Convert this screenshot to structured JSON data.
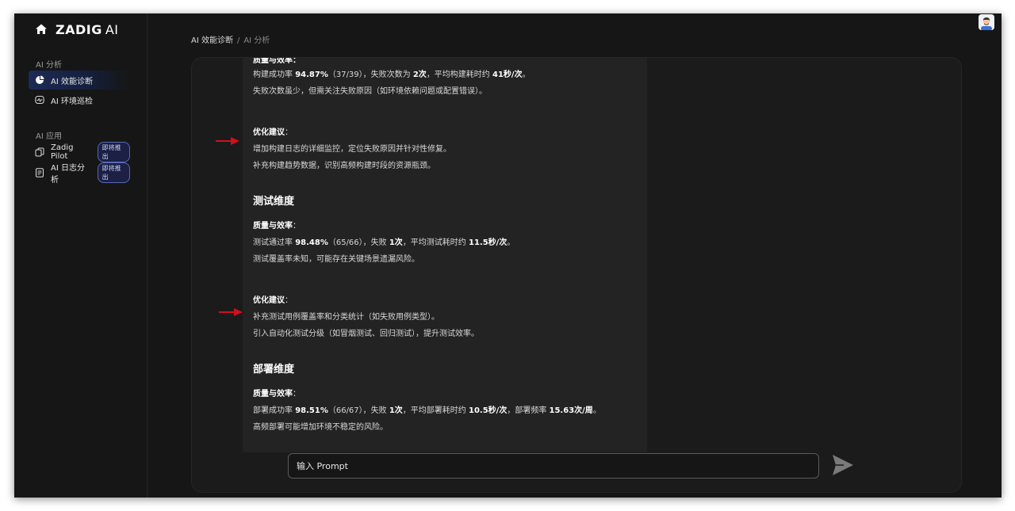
{
  "app": {
    "brand": "ZADIG",
    "brand_ai": "AI"
  },
  "sidebar": {
    "section1": "AI 分析",
    "items1": [
      {
        "label": "AI 效能诊断",
        "active": true
      },
      {
        "label": "AI 环境巡检"
      }
    ],
    "section2": "AI 应用",
    "items2": [
      {
        "label": "Zadig Pilot",
        "badge": "即将推出"
      },
      {
        "label": "AI 日志分析",
        "badge": "即将推出"
      }
    ]
  },
  "breadcrumb": {
    "parent": "AI 效能诊断",
    "sep": "/",
    "current": "AI 分析"
  },
  "report": {
    "build_top_heading": "质量与效率：",
    "build_metrics": {
      "pre1": "构建成功率 ",
      "v1": "94.87%",
      "pre2": "（37/39），失败次数为 ",
      "v2": "2次",
      "pre3": "，平均构建耗时约 ",
      "v3": "41秒/次",
      "post": "。"
    },
    "build_note": "失败次数虽少，但需关注失败原因（如环境依赖问题或配置错误）。",
    "build_opt_heading": "优化建议",
    "build_opt_colon": "：",
    "build_opt_1": "增加构建日志的详细监控，定位失败原因并针对性修复。",
    "build_opt_2": "补充构建趋势数据，识别高频构建时段的资源瓶颈。",
    "test_title": "测试维度",
    "test_q_heading": "质量与效率",
    "test_q_colon": "：",
    "test_metrics": {
      "pre1": "测试通过率 ",
      "v1": "98.48%",
      "pre2": "（65/66），失败 ",
      "v2": "1次",
      "pre3": "，平均测试耗时约 ",
      "v3": "11.5秒/次",
      "post": "。"
    },
    "test_note": "测试覆盖率未知，可能存在关键场景遗漏风险。",
    "test_opt_heading": "优化建议",
    "test_opt_colon": "：",
    "test_opt_1": "补充测试用例覆盖率和分类统计（如失败用例类型）。",
    "test_opt_2": "引入自动化测试分级（如冒烟测试、回归测试），提升测试效率。",
    "deploy_title": "部署维度",
    "deploy_q_heading": "质量与效率",
    "deploy_q_colon": "：",
    "deploy_metrics": {
      "pre1": "部署成功率 ",
      "v1": "98.51%",
      "pre2": "（66/67），失败 ",
      "v2": "1次",
      "pre3": "，平均部署耗时约 ",
      "v3": "10.5秒/次",
      "pre4": "，部署频率 ",
      "v4": "15.63次/周",
      "post": "。"
    },
    "deploy_note": "高频部署可能增加环境不稳定的风险。"
  },
  "prompt": {
    "placeholder": "输入 Prompt"
  },
  "colors": {
    "annotation_arrow": "#d0101c",
    "active_nav": "#1d2a55",
    "badge_border": "#5968b8"
  }
}
